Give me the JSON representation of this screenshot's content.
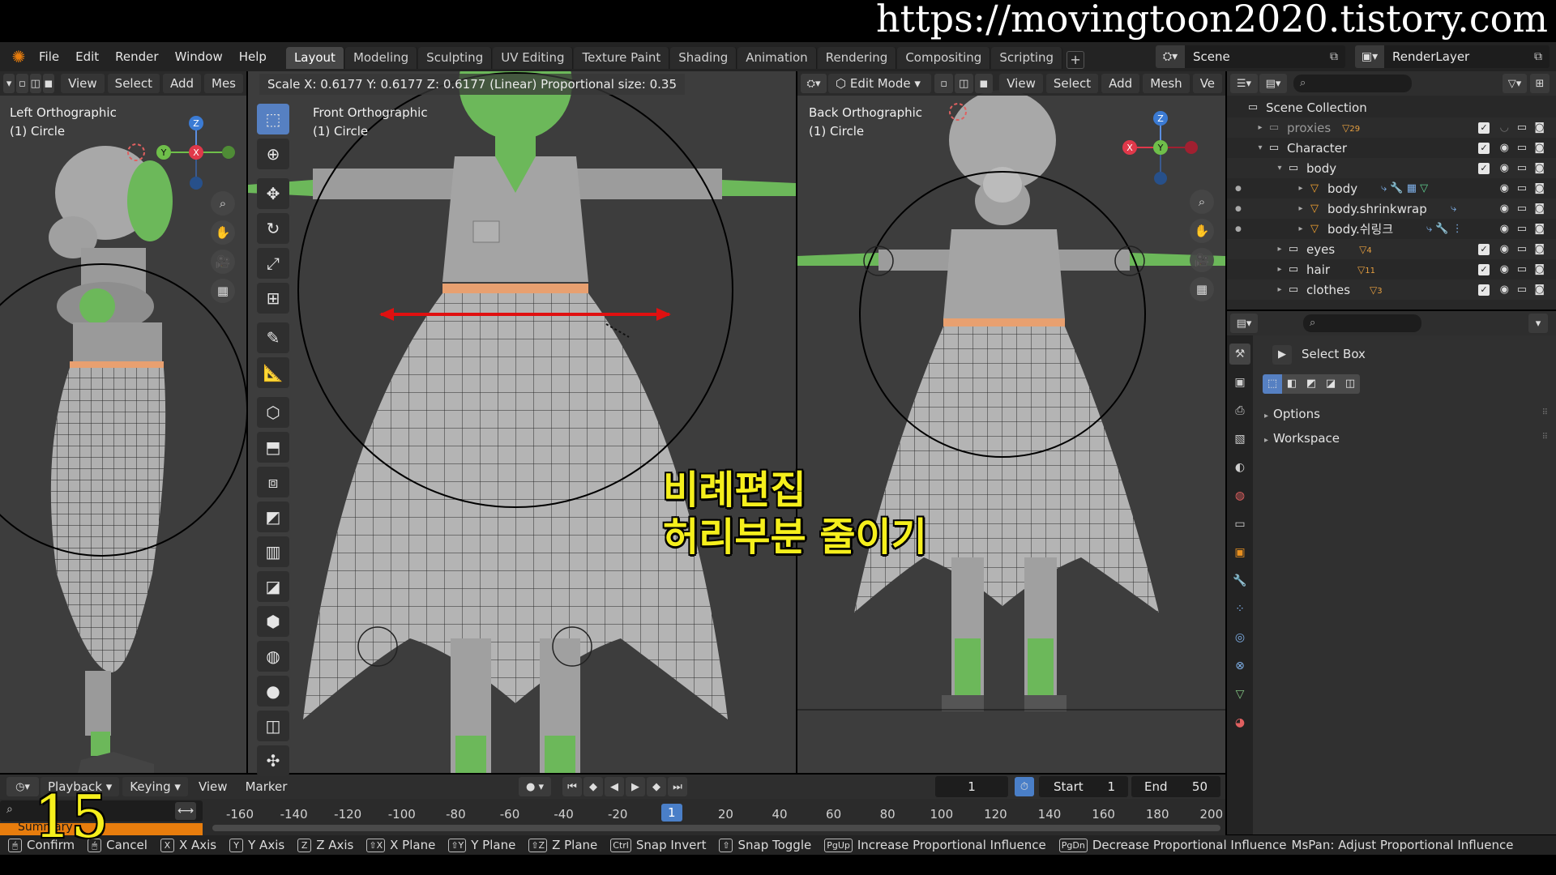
{
  "watermark": "https://movingtoon2020.tistory.com",
  "menu": [
    "File",
    "Edit",
    "Render",
    "Window",
    "Help"
  ],
  "workspaces": [
    "Layout",
    "Modeling",
    "Sculpting",
    "UV Editing",
    "Texture Paint",
    "Shading",
    "Animation",
    "Rendering",
    "Compositing",
    "Scripting"
  ],
  "scene_name": "Scene",
  "render_layer": "RenderLayer",
  "left_viewport": {
    "header": [
      "View",
      "Select",
      "Add",
      "Mes"
    ],
    "view_name": "Left Orthographic",
    "object": "(1) Circle",
    "gizmo": {
      "z": "Z",
      "y": "Y",
      "x": "X"
    }
  },
  "mid_viewport": {
    "view_name": "Front Orthographic",
    "object": "(1) Circle",
    "status": "Scale X: 0.6177   Y: 0.6177   Z: 0.6177 (Linear) Proportional size: 0.35"
  },
  "right_viewport": {
    "mode": "Edit Mode",
    "header": [
      "View",
      "Select",
      "Add",
      "Mesh",
      "Ve"
    ],
    "view_name": "Back Orthographic",
    "object": "(1) Circle",
    "gizmo": {
      "z": "Z",
      "y": "Y",
      "x": "X"
    }
  },
  "caption": {
    "line1": "비례편집",
    "line2": "허리부분 줄이기"
  },
  "outliner": {
    "rows": [
      {
        "label": "Scene Collection"
      },
      {
        "label": "proxies",
        "badge": "29"
      },
      {
        "label": "Character"
      },
      {
        "label": "body"
      },
      {
        "label": "body"
      },
      {
        "label": "body.shrinkwrap"
      },
      {
        "label": "body.쉬링크"
      },
      {
        "label": "eyes",
        "badge": "4"
      },
      {
        "label": "hair",
        "badge": "11"
      },
      {
        "label": "clothes",
        "badge": "3"
      }
    ]
  },
  "properties": {
    "tool": "Select Box",
    "panels": [
      "Options",
      "Workspace"
    ]
  },
  "timeline": {
    "header": [
      "Playback",
      "Keying",
      "View",
      "Marker"
    ],
    "current_frame": "1",
    "start_label": "Start",
    "start": "1",
    "end_label": "End",
    "end": "50",
    "ruler": [
      "-160",
      "-140",
      "-120",
      "-100",
      "-80",
      "-60",
      "-40",
      "-20",
      "1",
      "20",
      "40",
      "60",
      "80",
      "100",
      "120",
      "140",
      "160",
      "180",
      "200"
    ],
    "summary": "Summary"
  },
  "status_bar": [
    {
      "key": "",
      "text": "Confirm"
    },
    {
      "key": "",
      "text": "Cancel"
    },
    {
      "key": "X",
      "text": "X Axis"
    },
    {
      "key": "Y",
      "text": "Y Axis"
    },
    {
      "key": "Z",
      "text": "Z Axis"
    },
    {
      "key": "⇧X",
      "text": "X Plane"
    },
    {
      "key": "⇧Y",
      "text": "Y Plane"
    },
    {
      "key": "⇧Z",
      "text": "Z Plane"
    },
    {
      "key": "Ctrl",
      "text": "Snap Invert"
    },
    {
      "key": "⇧",
      "text": "Snap Toggle"
    },
    {
      "key": "PgUp",
      "text": "Increase Proportional Influence"
    },
    {
      "key": "PgDn",
      "text": "Decrease Proportional Influence"
    },
    {
      "key": "",
      "text": "MsPan: Adjust Proportional Influence"
    }
  ],
  "frame_overlay": "15",
  "colors": {
    "accent": "#5680c2",
    "caption": "#f5ef1c",
    "arrow": "#e01010",
    "skin": "#6cb85a",
    "belt": "#e8a070"
  }
}
